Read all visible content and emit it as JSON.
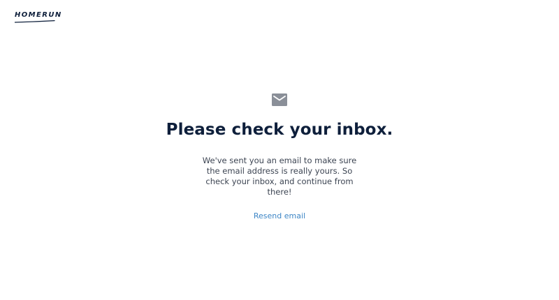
{
  "brand": {
    "logo_text": "HOMERUN",
    "color": "#0e1f3b"
  },
  "main": {
    "icon": "mail-icon",
    "icon_color": "#8a8f98",
    "title": "Please check your inbox.",
    "message": "We've sent you an email to make sure the email address is really yours. So check your inbox, and continue from there!",
    "resend_label": "Resend email",
    "link_color": "#3d86c6"
  }
}
